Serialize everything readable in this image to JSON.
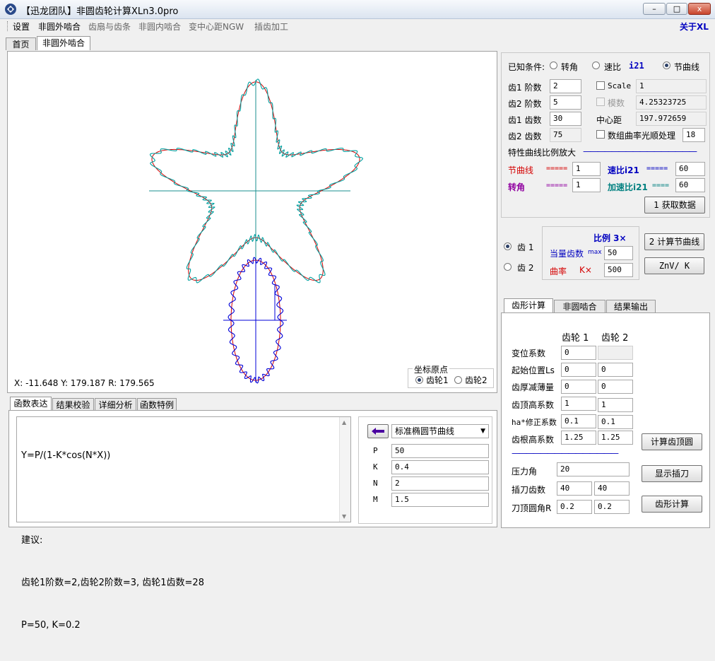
{
  "window": {
    "title": "【迅龙团队】非圆齿轮计算XLn3.0pro",
    "minimize_label": "–",
    "maximize_label": "□",
    "close_label": "x"
  },
  "menu": {
    "items": [
      "设置",
      "非圆外啮合",
      "齿扇与齿条",
      "非圆内啮合",
      "变中心距NGW",
      "插齿加工"
    ],
    "about": "关于XL"
  },
  "main_tabs": [
    "首页",
    "非圆外啮合"
  ],
  "canvas": {
    "readout": "X: -11.648   Y: 179.187   R: 179.565",
    "origin_group": "坐标原点",
    "origin_options": [
      "齿轮1",
      "齿轮2"
    ],
    "origin_selected": 0
  },
  "known": {
    "label": "已知条件:",
    "options": [
      "转角",
      "速比",
      "节曲线"
    ],
    "i21_label": "i21",
    "selected": 2
  },
  "params": {
    "gear1_order_label": "齿1 阶数",
    "gear1_order": "2",
    "gear2_order_label": "齿2 阶数",
    "gear2_order": "5",
    "gear1_teeth_label": "齿1 齿数",
    "gear1_teeth": "30",
    "gear2_teeth_label": "齿2 齿数",
    "gear2_teeth": "75",
    "scale_label": "Scale",
    "scale_value": "1",
    "module_label": "模数",
    "module_value": "4.25323725",
    "center_label": "中心距",
    "center_value": "197.972659",
    "smooth_label": "数组曲率光顺处理",
    "smooth_value": "18"
  },
  "scale_section": {
    "title": "特性曲线比例放大",
    "dash_line": "————————————————",
    "pitch_label": "节曲线",
    "pitch_eq": "=====",
    "pitch_value": "1",
    "speed_label": "速比i21",
    "speed_eq": "=====",
    "speed_value": "60",
    "angle_label": "转角",
    "angle_eq": "=====",
    "angle_value": "1",
    "accel_label": "加速比i21",
    "accel_eq": "====",
    "accel_value": "60",
    "get_data_btn": "1 获取数据"
  },
  "gear_select": {
    "options": [
      "齿 1",
      "齿 2"
    ],
    "selected": 0,
    "ratio_label": "比例 3×",
    "teeth_label": "当量齿数",
    "max_label": "max",
    "teeth_value": "50",
    "curv_label": "曲率",
    "kx_label": "K×",
    "curv_value": "500",
    "calc_pitch_btn": "2 计算节曲线",
    "znvk_btn": "ZnV/ K"
  },
  "bottom_tabs": [
    "函数表达",
    "结果校验",
    "详细分析",
    "函数特例"
  ],
  "function": {
    "lines": [
      "Y=P/(1-K*cos(N*X))",
      "",
      "建议:",
      "齿轮1阶数=2,齿轮2阶数=3, 齿轮1齿数=28",
      "P=50, K=0.2"
    ],
    "combo_value": "标准椭圆节曲线",
    "param_names": [
      "P",
      "K",
      "N",
      "M"
    ],
    "param_values": [
      "50",
      "0.4",
      "2",
      "1.5"
    ]
  },
  "right_tabs": [
    "齿形计算",
    "非圆啮合",
    "结果输出"
  ],
  "tooth": {
    "col1": "齿轮 1",
    "col2": "齿轮 2",
    "rows": [
      {
        "label": "变位系数",
        "v1": "0",
        "v2": ""
      },
      {
        "label": "起始位置Ls",
        "v1": "0",
        "v2": "0"
      },
      {
        "label": "齿厚减薄量",
        "v1": "0",
        "v2": "0"
      },
      {
        "label": "齿顶高系数",
        "v1": "1",
        "v2": "1"
      },
      {
        "label": "ha*修正系数",
        "v1": "0.1",
        "v2": "0.1"
      },
      {
        "label": "齿根高系数",
        "v1": "1.25",
        "v2": "1.25"
      }
    ],
    "divider": "———————————————",
    "pressure_label": "压力角",
    "pressure_value": "20",
    "cutter_teeth_label": "插刀齿数",
    "cutter_teeth_1": "40",
    "cutter_teeth_2": "40",
    "tip_radius_label": "刀顶圆角R",
    "tip_radius_1": "0.2",
    "tip_radius_2": "0.2",
    "calc_tip_btn": "计算齿顶圆",
    "show_cutter_btn": "显示插刀",
    "tooth_calc_btn": "齿形计算"
  },
  "colors": {
    "pitch_red": "#d40000",
    "teeth_teal": "#00a0a0",
    "gear_blue": "#0000d8",
    "axis_teal": "#1a8f8f",
    "title_blue": "#0000c0",
    "purple": "#9000a0",
    "teal_label": "#008080"
  }
}
